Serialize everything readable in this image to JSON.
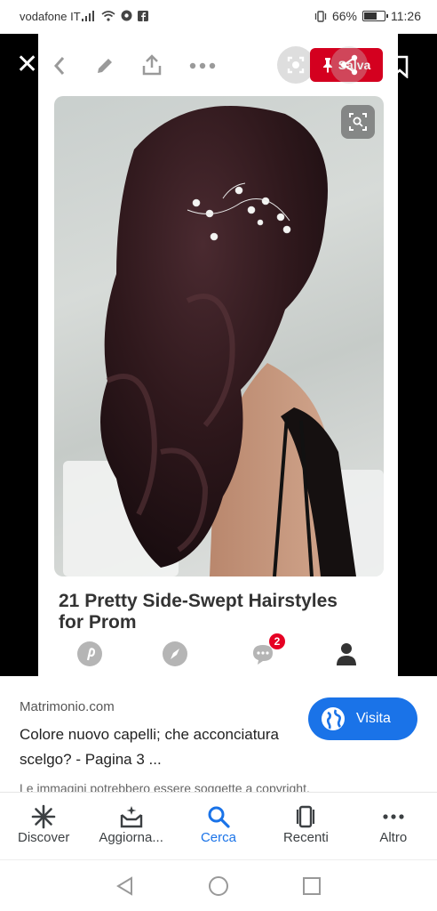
{
  "status": {
    "carrier": "vodafone IT",
    "battery": "66%",
    "time": "11:26"
  },
  "viewer": {
    "save_label": "Salva",
    "pin_title": "21 Pretty Side-Swept Hairstyles for Prom",
    "notification_count": "2"
  },
  "info": {
    "source": "Matrimonio.com",
    "description": "Colore nuovo capelli; che acconciatura scelgo? - Pagina 3 ...",
    "visit_label": "Visita",
    "copyright": "Le immagini potrebbero essere soggette a copyright."
  },
  "bottom_nav": [
    {
      "label": "Discover",
      "icon": "asterisk-icon"
    },
    {
      "label": "Aggiorna...",
      "icon": "updates-icon"
    },
    {
      "label": "Cerca",
      "icon": "search-icon"
    },
    {
      "label": "Recenti",
      "icon": "recent-icon"
    },
    {
      "label": "Altro",
      "icon": "more-icon"
    }
  ],
  "colors": {
    "accent": "#1a73e8",
    "pinterest_red": "#e60023"
  }
}
